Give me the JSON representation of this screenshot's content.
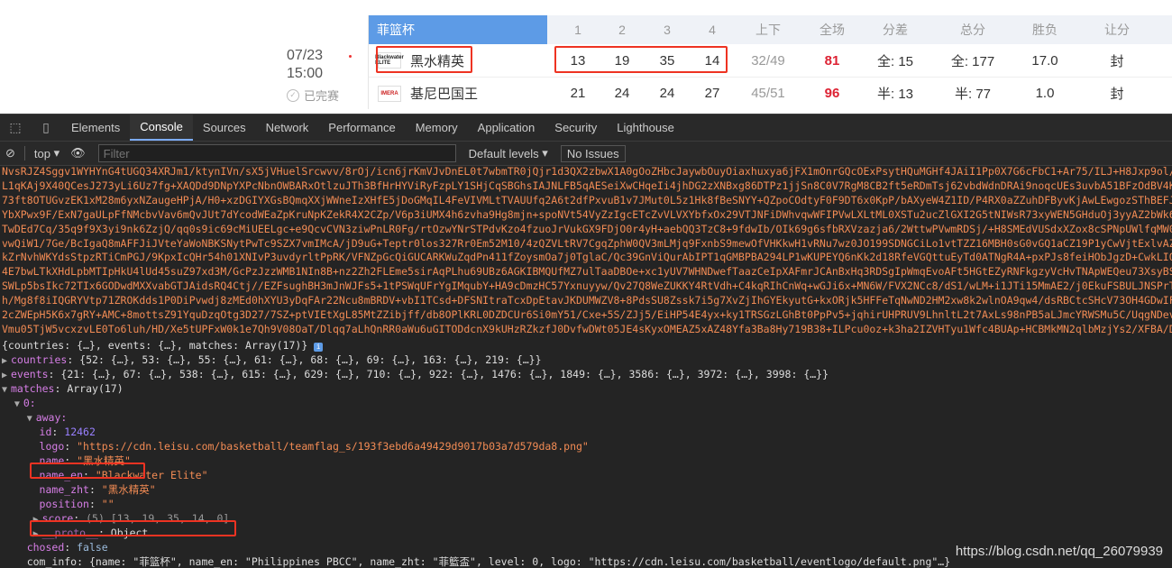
{
  "match": {
    "date": "07/23",
    "time": "15:00",
    "status": "已完赛",
    "league": "菲篮杯",
    "headers": [
      "1",
      "2",
      "3",
      "4",
      "上下",
      "全场",
      "分差",
      "总分",
      "胜负",
      "让分"
    ],
    "teams": [
      {
        "logo_text": "Blackwater ELITE",
        "name": "黑水精英",
        "q": [
          "13",
          "19",
          "35",
          "14"
        ],
        "half": "32/49",
        "total": "81",
        "diff": "全: 15",
        "sum": "全: 177",
        "wl": "17.0",
        "handicap": "封"
      },
      {
        "logo_text": "IMERA",
        "name": "基尼巴国王",
        "q": [
          "21",
          "24",
          "24",
          "27"
        ],
        "half": "45/51",
        "total": "96",
        "diff": "半: 13",
        "sum": "半: 77",
        "wl": "1.0",
        "handicap": "封"
      }
    ]
  },
  "devtools": {
    "tabs": [
      "Elements",
      "Console",
      "Sources",
      "Network",
      "Performance",
      "Memory",
      "Application",
      "Security",
      "Lighthouse"
    ],
    "active_tab": "Console",
    "context": "top",
    "filter_placeholder": "Filter",
    "levels": "Default levels",
    "issues": "No Issues",
    "blob_lines": [
      "NvsRJZ4Sggv1WYHYnG4tUGQ34XRJm1/ktynIVn/sX5jVHuelSrcwvv/8rOj/icn6jrKmVJvDnEL0t7wbmTR0jQjr1d3QX2zbwX1A0gOoZHbcJaywbOuyOiaxhuxya6jFX1mOnrGQcOExPsytHQuMGHf4JAiI1Pp0X7G6cFbC1+Ar75/ILJ+H8Jxp9ol/+AdEwUE+f",
      "L1qKAj9X40QCesJ273yLi6Uz7fg+XAQDd9DNpYXPcNbnOWBARxOtlzuJTh3BfHrHYViRyFzpLY1SHjCqSBGhsIAJNLFB5qAESeiXwCHqeIi4jhDG2zXNBxg86DTPz1jjSn8C0V7RgM8CB2ft5eRDmTsj62vbdWdnDRAi9noqcUEs3uvbA51BFzOdBV4K/CBSBDyPWU",
      "73ft8OTUGvzEK1xM28m6yxNZaugeHPjA/H0+xzDGIYXGsBQmqXXjWWneIzXHfE5jDoGMqIL4FeVIVMLtTVAUUfq2A6t2dfPxvuB1v7JMut0L5z1Hk8fBeSNYY+QZpoCOdtyF0F9DT6x0KpP/bAXyeW4Z1ID/P4RX0aZZuhDFByvKjAwLEwgozSThBEFJrRJhTDg4A",
      "YbXPwx9F/ExN7gaULpFfNMcbvVav6mQvJUt7dYcodWEaZpKruNpKZekR4X2CZp/V6p3iUMX4h6zvha9Hg8mjn+spoNVt54VyZzIgcETcZvVLVXYbfxOx29VTJNFiDWhvqwWFIPVwLXLtML0XSTu2ucZlGXI2G5tNIWsR73xyWEN5GHduOj3yyAZ2bWk6uUZPW2p1V",
      "TwDEd7Cq/35q9f9X3yi9nk6ZzjQ/qq0s9ic69cMiUEELgc+e9QcvCVN3ziwPnLR0Fg/rtOzwYNrSTPdvKzo4fzuoJrVukGX9FDjO0r4yH+aebQQ3TzC8+9fdwIb/OIk69g6sfbRXVzazja6/2WttwPVwmRDSj/+H8SMEdVUSdxXZox8cSPNpUWlfqMW0V9/f738P+m",
      "vwQiW1/7Ge/BcIgaQ8mAFFJiJVteYaWoNBKSNytPwTc9SZX7vmIMcA/jD9uG+Teptr0los327Rr0Em52M10/4zQZVLtRV7CgqZphW0QV3mLMjq9FxnbS9mewOfVHKkwH1vRNu7wz0JO199SDNGCiLo1vtTZZ16MBH0sG0vGQ1aCZ19P1yCwVjtExlvAZqnWkVM4z",
      "kZrNvhWKYdsStpzRTiCmPGJ/9KpxIcQHr54h01XNIvP3uvdyrltPpRK/VFNZpGcQiGUCARKWuZqdPn411fZoysmOa7j0TglaC/Qc39GnViQurAbIPT1qGMBPBA294LP1wKUPEYQ6nKk2d18RfeVGQttuEyTd0ATNgR4A+pxPJs8feiHObJgzD+CwkLIQU2QW+ToQ8",
      "4E7bwLTkXHdLpbMTIpHkU4lUd45suZ97xd3M/GcPzJzzWMB1NIn8B+nz2Zh2FLEme5sirAqPLhu69UBz6AGKIBMQUfMZ7ulTaaDBOe+xc1yUV7WHNDwefTaazCeIpXAFmrJCAnBxHq3RDSgIpWmqEvoAFt5HGtEZyRNFkgzyVcHvTNApWEQeu73XsyBSBATdb4WoZ2",
      "SWLp5bsIkc72TIx6GODwdMXXvabGTJAidsRQ4Ctj//EZFsughBH3mJnWJFs5+1tPSWqUFrYgIMqubY+HA9cDmzHC57Yxnuyyw/Qv27Q8WeZUKKY4RtVdh+C4kqRIhCnWq+wGJi6x+MN6W/FVX2NCc8/dS1/wLM+i1JTi15MmAE2/j0EkuFSBULJNSPrTc9PkdifhR",
      "h/Mg8f8iIQGRYVtp71ZROKdds1P0DiPvwdj8zMEd0hXYU3yDqFAr22Ncu8mBRDV+vbI1TCsd+DFSNItraTcxDpEtavJKDUMWZV8+8PdsSU8Zssk7i5g7XvZjIhGYEkyutG+kxORjk5HFFeTqNwND2HM2xw8k2wlnOA9qw4/dsRBCtcSHcV73OH4GDwIF1z19fFHDnz",
      "2cZWEpH5K6x7gRY+AMC+8mottsZ91YquDzqOtg3D27/7SZ+ptVIEtXgL85MtZZibjff/db8OPlKRL0DZDCUr6Si0mY51/Cxe+5S/ZJj5/EiHP54E4yx+ky1TRSGzLGhBt0PpPv5+jqhirUHPRUV9LhnltL2t7AxLs98nPB5aLJmcYRWSMu5C/UqgNDevIFkiuFK1Z",
      "Vmu05TjW5vcxzvLE0To6luh/HD/Xe5tUPFxW0k1e7Qh9V08OaT/Dlqq7aLhQnRR0aWu6uGITODdcnX9kUHzRZkzfJ0DvfwDWt05JE4sKyxOMEAZ5xAZ48Yfa3Ba8Hy719B38+ILPcu0oz+k3ha2IZVHTyu1Wfc4BUAp+HCBMkMN2qlbMzjYs2/XFBA/D1cQRVnx2y",
      "EvvbuIIHPj2bG4EeEQuLuz+jt1yf3a+0sYzOIRnCUJ8plhwkAIvepm0wQnfEzhTtiXX2FTHfTlQDTDU5NSayKwkPBpNKCsHO81a6E1URz7fEOedyh8SLLn//GOjF1f+des/B3ZFL7MiJnGvapFfeXOATpXdSfZEuL0Br3StBQFEHLPBKJpTj/ZAJ2F9VAQ1Uwzwuo",
      "+tkmFv33kGp9xODG3Sg/YDF4IOTh4c2Uy21zjm/qrFmy87w0YbXgs/T4AZziuszHUPRit/RUELTD==\", 13)))"
    ],
    "summary": "{countries: {…}, events: {…}, matches: Array(17)}",
    "summary_badge": "i",
    "countries_key": "countries",
    "countries_val": "{52: {…}, 53: {…}, 55: {…}, 61: {…}, 68: {…}, 69: {…}, 163: {…}, 219: {…}}",
    "events_key": "events",
    "events_val": "{21: {…}, 67: {…}, 538: {…}, 615: {…}, 629: {…}, 710: {…}, 922: {…}, 1476: {…}, 1849: {…}, 3586: {…}, 3972: {…}, 3998: {…}}",
    "matches_key": "matches",
    "matches_val": "Array(17)",
    "index0": "0:",
    "away_key": "away:",
    "fields": [
      {
        "key": "id",
        "val": "12462",
        "type": "num"
      },
      {
        "key": "logo",
        "val": "\"https://cdn.leisu.com/basketball/teamflag_s/193f3ebd6a49429d9017b03a7d579da8.png\"",
        "type": "str"
      },
      {
        "key": "name",
        "val": "\"黑水精英\"",
        "type": "str"
      },
      {
        "key": "name_en",
        "val": "\"Blackwater Elite\"",
        "type": "str"
      },
      {
        "key": "name_zht",
        "val": "\"黑水精英\"",
        "type": "str"
      },
      {
        "key": "position",
        "val": "\"\"",
        "type": "str"
      }
    ],
    "score_key": "score",
    "score_val": "(5) [13, 19, 35, 14, 0]",
    "proto_key": "__proto__",
    "proto_val": "Object",
    "chosed_key": "chosed",
    "chosed_val": "false",
    "cut_line": "com_info: {name: \"菲篮杯\", name_en: \"Philippines PBCC\", name_zht: \"菲籃盃\", level: 0, logo: \"https://cdn.leisu.com/basketball/eventlogo/default.png\"…}"
  },
  "watermark": "https://blog.csdn.net/qq_26079939",
  "colors": {
    "highlight": "#ee3322",
    "league_blue": "#5d9be6",
    "total_red": "#dd2233"
  }
}
